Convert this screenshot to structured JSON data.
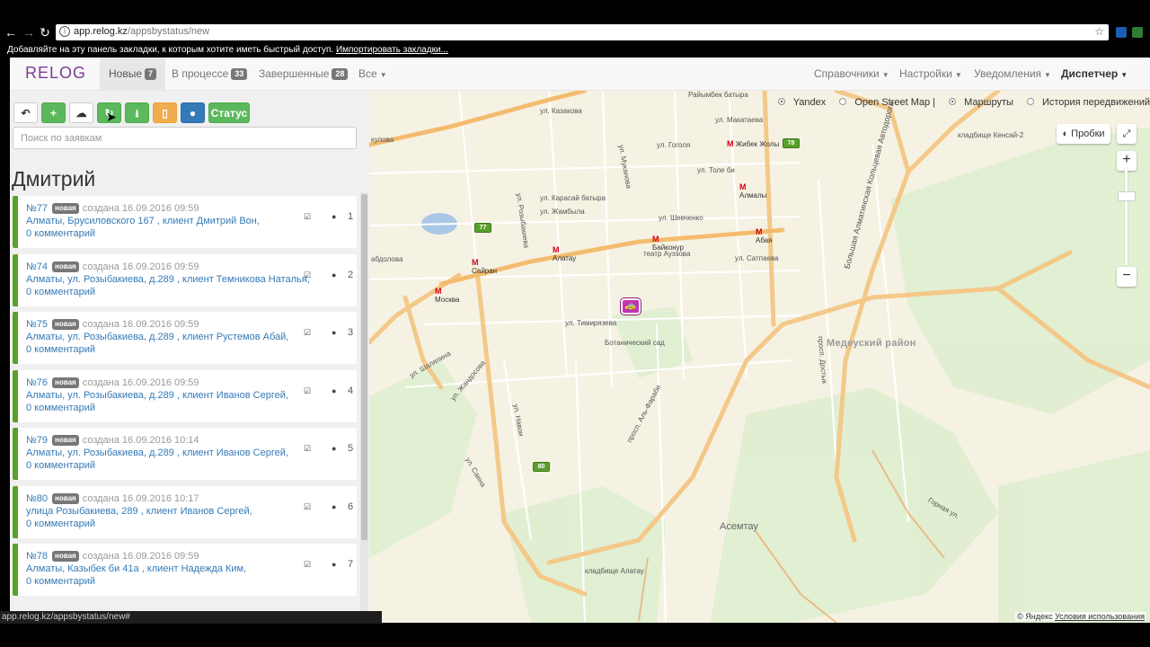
{
  "browser": {
    "url_host": "app.relog.kz",
    "url_path": "/appsbystatus/new",
    "bookmarks_text": "Добавляйте на эту панель закладки, к которым хотите иметь быстрый доступ.",
    "bookmarks_link": "Импортировать закладки...",
    "status_url": "app.relog.kz/appsbystatus/new#"
  },
  "nav": {
    "logo": "RELOG",
    "tabs": [
      {
        "label": "Новые",
        "count": "7"
      },
      {
        "label": "В процессе",
        "count": "33"
      },
      {
        "label": "Завершенные",
        "count": "28"
      },
      {
        "label": "Все"
      }
    ],
    "right": [
      "Справочники",
      "Настройки",
      "Уведомления",
      "Диспетчер"
    ]
  },
  "toolbar": {
    "status_label": "Статус",
    "search_placeholder": "Поиск по заявкам"
  },
  "group_title": "Дмитрий",
  "orders": [
    {
      "num": "№77",
      "badge": "новая",
      "created": "создана 16.09.2016 09:59",
      "address": "Алматы, Брусиловского 167 , клиент Дмитрий Вон,",
      "comments": "0 комментарий",
      "index": "1"
    },
    {
      "num": "№74",
      "badge": "новая",
      "created": "создана 16.09.2016 09:59",
      "address": "Алматы, ул. Розыбакиева, д.289 , клиент Темникова Наталья,",
      "comments": "0 комментарий",
      "index": "2"
    },
    {
      "num": "№75",
      "badge": "новая",
      "created": "создана 16.09.2016 09:59",
      "address": "Алматы, ул. Розыбакиева, д.289 , клиент Рустемов Абай,",
      "comments": "0 комментарий",
      "index": "3"
    },
    {
      "num": "№76",
      "badge": "новая",
      "created": "создана 16.09.2016 09:59",
      "address": "Алматы, ул. Розыбакиева, д.289 , клиент Иванов Сергей,",
      "comments": "0 комментарий",
      "index": "4"
    },
    {
      "num": "№79",
      "badge": "новая",
      "created": "создана 16.09.2016 10:14",
      "address": "Алматы, ул. Розыбакиева, д.289 , клиент Иванов Сергей,",
      "comments": "0 комментарий",
      "index": "5"
    },
    {
      "num": "№80",
      "badge": "новая",
      "created": "создана 16.09.2016 10:17",
      "address": "улица Розыбакиева, 289 , клиент Иванов Сергей,",
      "comments": "0 комментарий",
      "index": "6"
    },
    {
      "num": "№78",
      "badge": "новая",
      "created": "создана 16.09.2016 09:59",
      "address": "Алматы, Казыбек би 41а , клиент Надежда Ким,",
      "comments": "0 комментарий",
      "index": "7"
    }
  ],
  "map": {
    "layers": [
      "Yandex",
      "Open Street Map |",
      "Маршруты",
      "История передвижений"
    ],
    "traffic_label": "Пробки",
    "markers": [
      "77",
      "78",
      "80"
    ],
    "district": "Медеуский район",
    "metro": [
      "Жибек Жолы",
      "Алмалы",
      "Абая",
      "Байконур",
      "Алатау",
      "Сайран",
      "Москва"
    ],
    "streets": [
      "ул. Казакова",
      "Райымбек батыра",
      "ул. Макатаева",
      "ул. Гоголя",
      "ул. Толе би",
      "ул. Карасай батыра",
      "ул. Жамбыла",
      "ул. Шевченко",
      "ул. Сатпаева",
      "ул. Тимирязева",
      "ул. Шаляпина",
      "ул. Жандосова",
      "ул. Навои",
      "ул. Саина",
      "просп. Аль-Фараби",
      "просп. Достык",
      "Большая Алматинская Кольцевая Автодорога",
      "Горная ул.",
      "ул. Розыбакиева",
      "ул. Муканова",
      "кулова",
      "абдолова"
    ],
    "places": [
      "Ботанический сад",
      "Асемтау",
      "кладбище Алатау",
      "кладбище Кенсай-2",
      "театр Ауэзова"
    ],
    "copyright": "© Яндекс",
    "terms": "Условия использования"
  }
}
